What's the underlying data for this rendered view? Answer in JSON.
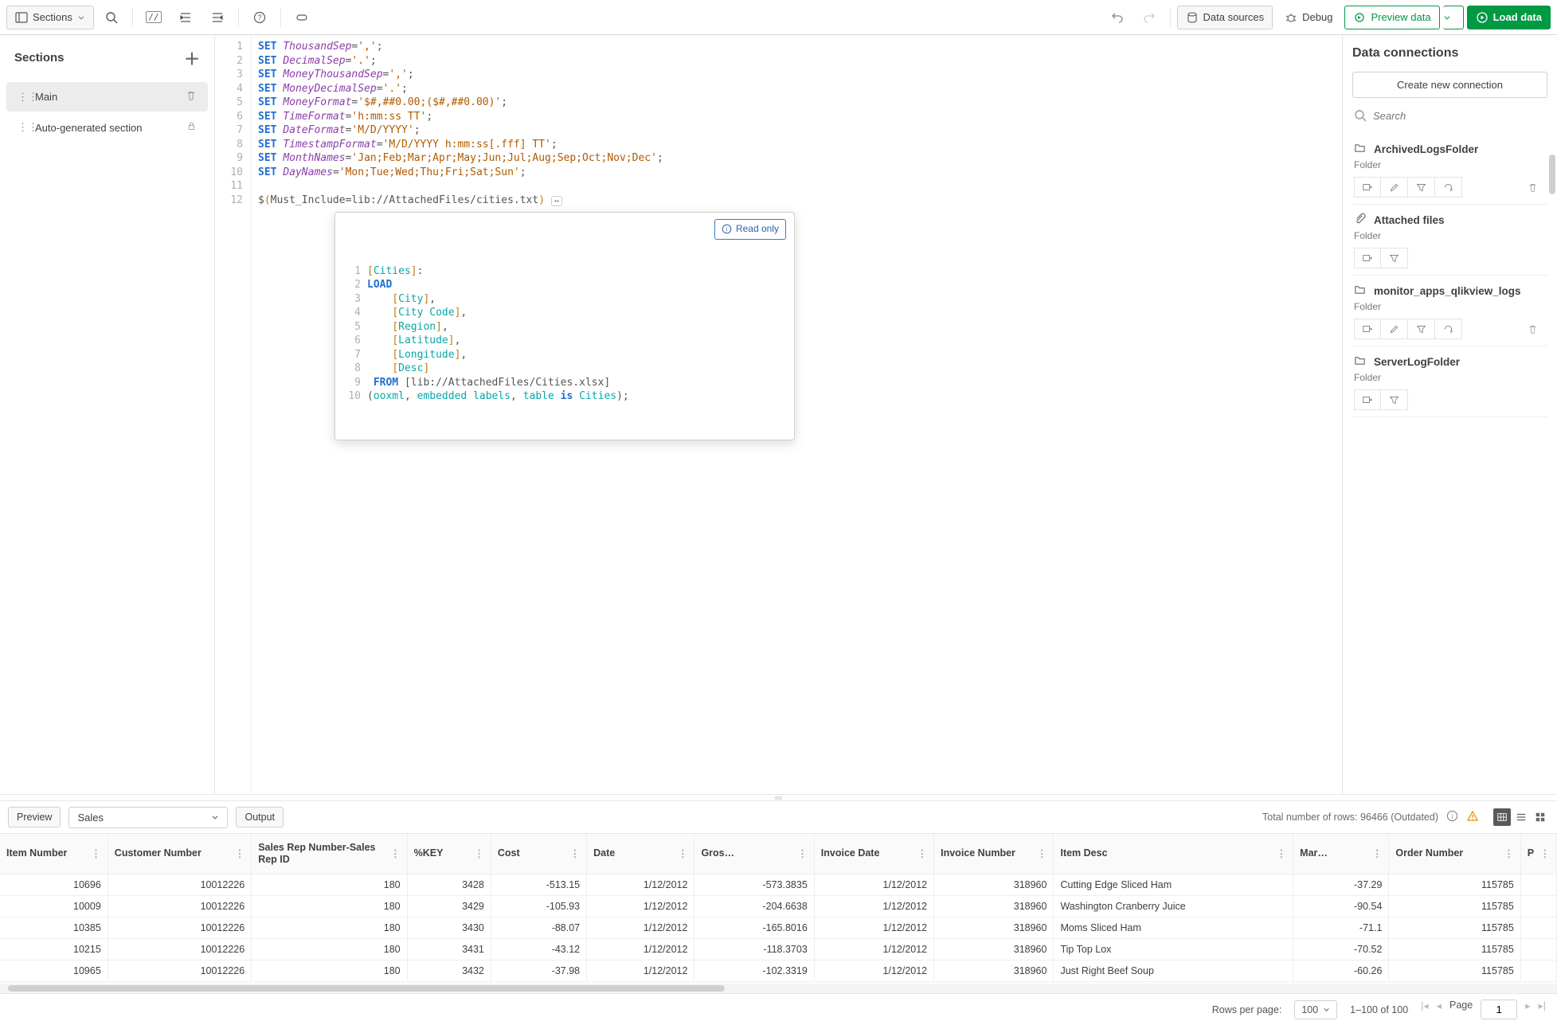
{
  "toolbar": {
    "sections_btn": "Sections",
    "data_sources": "Data sources",
    "debug": "Debug",
    "preview_data": "Preview data",
    "load_data": "Load data"
  },
  "sections": {
    "title": "Sections",
    "items": [
      {
        "label": "Main",
        "trailing": "trash"
      },
      {
        "label": "Auto-generated section",
        "trailing": "lock"
      }
    ]
  },
  "code": {
    "lines": [
      {
        "n": 1,
        "tokens": [
          [
            "kw",
            "SET"
          ],
          [
            "plain",
            " "
          ],
          [
            "var",
            "ThousandSep"
          ],
          [
            "plain",
            "="
          ],
          [
            "str",
            "','"
          ],
          [
            "plain",
            ";"
          ]
        ]
      },
      {
        "n": 2,
        "tokens": [
          [
            "kw",
            "SET"
          ],
          [
            "plain",
            " "
          ],
          [
            "var",
            "DecimalSep"
          ],
          [
            "plain",
            "="
          ],
          [
            "str",
            "'.'"
          ],
          [
            "plain",
            ";"
          ]
        ]
      },
      {
        "n": 3,
        "tokens": [
          [
            "kw",
            "SET"
          ],
          [
            "plain",
            " "
          ],
          [
            "var",
            "MoneyThousandSep"
          ],
          [
            "plain",
            "="
          ],
          [
            "str",
            "','"
          ],
          [
            "plain",
            ";"
          ]
        ]
      },
      {
        "n": 4,
        "tokens": [
          [
            "kw",
            "SET"
          ],
          [
            "plain",
            " "
          ],
          [
            "var",
            "MoneyDecimalSep"
          ],
          [
            "plain",
            "="
          ],
          [
            "str",
            "'.'"
          ],
          [
            "plain",
            ";"
          ]
        ]
      },
      {
        "n": 5,
        "tokens": [
          [
            "kw",
            "SET"
          ],
          [
            "plain",
            " "
          ],
          [
            "var",
            "MoneyFormat"
          ],
          [
            "plain",
            "="
          ],
          [
            "str",
            "'$#,##0.00;($#,##0.00)'"
          ],
          [
            "plain",
            ";"
          ]
        ]
      },
      {
        "n": 6,
        "tokens": [
          [
            "kw",
            "SET"
          ],
          [
            "plain",
            " "
          ],
          [
            "var",
            "TimeFormat"
          ],
          [
            "plain",
            "="
          ],
          [
            "str",
            "'h:mm:ss TT'"
          ],
          [
            "plain",
            ";"
          ]
        ]
      },
      {
        "n": 7,
        "tokens": [
          [
            "kw",
            "SET"
          ],
          [
            "plain",
            " "
          ],
          [
            "var",
            "DateFormat"
          ],
          [
            "plain",
            "="
          ],
          [
            "str",
            "'M/D/YYYY'"
          ],
          [
            "plain",
            ";"
          ]
        ]
      },
      {
        "n": 8,
        "tokens": [
          [
            "kw",
            "SET"
          ],
          [
            "plain",
            " "
          ],
          [
            "var",
            "TimestampFormat"
          ],
          [
            "plain",
            "="
          ],
          [
            "str",
            "'M/D/YYYY h:mm:ss[.fff] TT'"
          ],
          [
            "plain",
            ";"
          ]
        ]
      },
      {
        "n": 9,
        "tokens": [
          [
            "kw",
            "SET"
          ],
          [
            "plain",
            " "
          ],
          [
            "var",
            "MonthNames"
          ],
          [
            "plain",
            "="
          ],
          [
            "str",
            "'Jan;Feb;Mar;Apr;May;Jun;Jul;Aug;Sep;Oct;Nov;Dec'"
          ],
          [
            "plain",
            ";"
          ]
        ]
      },
      {
        "n": 10,
        "tokens": [
          [
            "kw",
            "SET"
          ],
          [
            "plain",
            " "
          ],
          [
            "var",
            "DayNames"
          ],
          [
            "plain",
            "="
          ],
          [
            "str",
            "'Mon;Tue;Wed;Thu;Fri;Sat;Sun'"
          ],
          [
            "plain",
            ";"
          ]
        ]
      },
      {
        "n": 11,
        "tokens": []
      },
      {
        "n": 12,
        "tokens": [
          [
            "plain",
            "$"
          ],
          [
            "orange",
            "("
          ],
          [
            "plain",
            "Must_Include=lib://AttachedFiles/cities.txt"
          ],
          [
            "orange",
            ")"
          ]
        ]
      }
    ]
  },
  "readonly": {
    "badge": "Read only",
    "lines": [
      {
        "n": 1,
        "tokens": [
          [
            "orange",
            "["
          ],
          [
            "teal",
            "Cities"
          ],
          [
            "orange",
            "]"
          ],
          [
            "plain",
            ":"
          ]
        ]
      },
      {
        "n": 2,
        "tokens": [
          [
            "kw",
            "LOAD"
          ]
        ]
      },
      {
        "n": 3,
        "tokens": [
          [
            "plain",
            "    "
          ],
          [
            "orange",
            "["
          ],
          [
            "teal",
            "City"
          ],
          [
            "orange",
            "]"
          ],
          [
            "plain",
            ","
          ]
        ]
      },
      {
        "n": 4,
        "tokens": [
          [
            "plain",
            "    "
          ],
          [
            "orange",
            "["
          ],
          [
            "teal",
            "City Code"
          ],
          [
            "orange",
            "]"
          ],
          [
            "plain",
            ","
          ]
        ]
      },
      {
        "n": 5,
        "tokens": [
          [
            "plain",
            "    "
          ],
          [
            "orange",
            "["
          ],
          [
            "teal",
            "Region"
          ],
          [
            "orange",
            "]"
          ],
          [
            "plain",
            ","
          ]
        ]
      },
      {
        "n": 6,
        "tokens": [
          [
            "plain",
            "    "
          ],
          [
            "orange",
            "["
          ],
          [
            "teal",
            "Latitude"
          ],
          [
            "orange",
            "]"
          ],
          [
            "plain",
            ","
          ]
        ]
      },
      {
        "n": 7,
        "tokens": [
          [
            "plain",
            "    "
          ],
          [
            "orange",
            "["
          ],
          [
            "teal",
            "Longitude"
          ],
          [
            "orange",
            "]"
          ],
          [
            "plain",
            ","
          ]
        ]
      },
      {
        "n": 8,
        "tokens": [
          [
            "plain",
            "    "
          ],
          [
            "orange",
            "["
          ],
          [
            "teal",
            "Desc"
          ],
          [
            "orange",
            "]"
          ]
        ]
      },
      {
        "n": 9,
        "tokens": [
          [
            "plain",
            " "
          ],
          [
            "kw",
            "FROM"
          ],
          [
            "plain",
            " [lib://AttachedFiles/Cities.xlsx]"
          ]
        ]
      },
      {
        "n": 10,
        "tokens": [
          [
            "plain",
            "("
          ],
          [
            "teal",
            "ooxml"
          ],
          [
            "plain",
            ", "
          ],
          [
            "teal",
            "embedded labels"
          ],
          [
            "plain",
            ", "
          ],
          [
            "teal",
            "table"
          ],
          [
            "plain",
            " "
          ],
          [
            "kw",
            "is"
          ],
          [
            "plain",
            " "
          ],
          [
            "teal",
            "Cities"
          ],
          [
            "plain",
            ");"
          ]
        ]
      }
    ]
  },
  "connections": {
    "title": "Data connections",
    "create": "Create new connection",
    "search_placeholder": "Search",
    "items": [
      {
        "name": "ArchivedLogsFolder",
        "type": "Folder",
        "icon": "folder"
      },
      {
        "name": "Attached files",
        "type": "Folder",
        "icon": "attach"
      },
      {
        "name": "monitor_apps_qlikview_logs",
        "type": "Folder",
        "icon": "folder"
      },
      {
        "name": "ServerLogFolder",
        "type": "Folder",
        "icon": "folder"
      }
    ]
  },
  "preview": {
    "preview_btn": "Preview",
    "table_select": "Sales",
    "output_btn": "Output",
    "rowcount": "Total number of rows: 96466 (Outdated)",
    "columns": [
      "Item Number",
      "Customer Number",
      "Sales Rep Number-Sales Rep ID",
      "%KEY",
      "Cost",
      "Date",
      "Gros…",
      "Invoice Date",
      "Invoice Number",
      "Item Desc",
      "Mar…",
      "Order Number",
      "P"
    ],
    "rows": [
      [
        "10696",
        "10012226",
        "180",
        "3428",
        "-513.15",
        "1/12/2012",
        "-573.3835",
        "1/12/2012",
        "318960",
        "Cutting Edge Sliced Ham",
        "-37.29",
        "115785"
      ],
      [
        "10009",
        "10012226",
        "180",
        "3429",
        "-105.93",
        "1/12/2012",
        "-204.6638",
        "1/12/2012",
        "318960",
        "Washington Cranberry Juice",
        "-90.54",
        "115785"
      ],
      [
        "10385",
        "10012226",
        "180",
        "3430",
        "-88.07",
        "1/12/2012",
        "-165.8016",
        "1/12/2012",
        "318960",
        "Moms Sliced Ham",
        "-71.1",
        "115785"
      ],
      [
        "10215",
        "10012226",
        "180",
        "3431",
        "-43.12",
        "1/12/2012",
        "-118.3703",
        "1/12/2012",
        "318960",
        "Tip Top Lox",
        "-70.52",
        "115785"
      ],
      [
        "10965",
        "10012226",
        "180",
        "3432",
        "-37.98",
        "1/12/2012",
        "-102.3319",
        "1/12/2012",
        "318960",
        "Just Right Beef Soup",
        "-60.26",
        "115785"
      ]
    ]
  },
  "pager": {
    "rows_per_page_label": "Rows per page:",
    "rows_per_page": "100",
    "range": "1–100 of 100",
    "page_label": "Page",
    "page": "1"
  }
}
